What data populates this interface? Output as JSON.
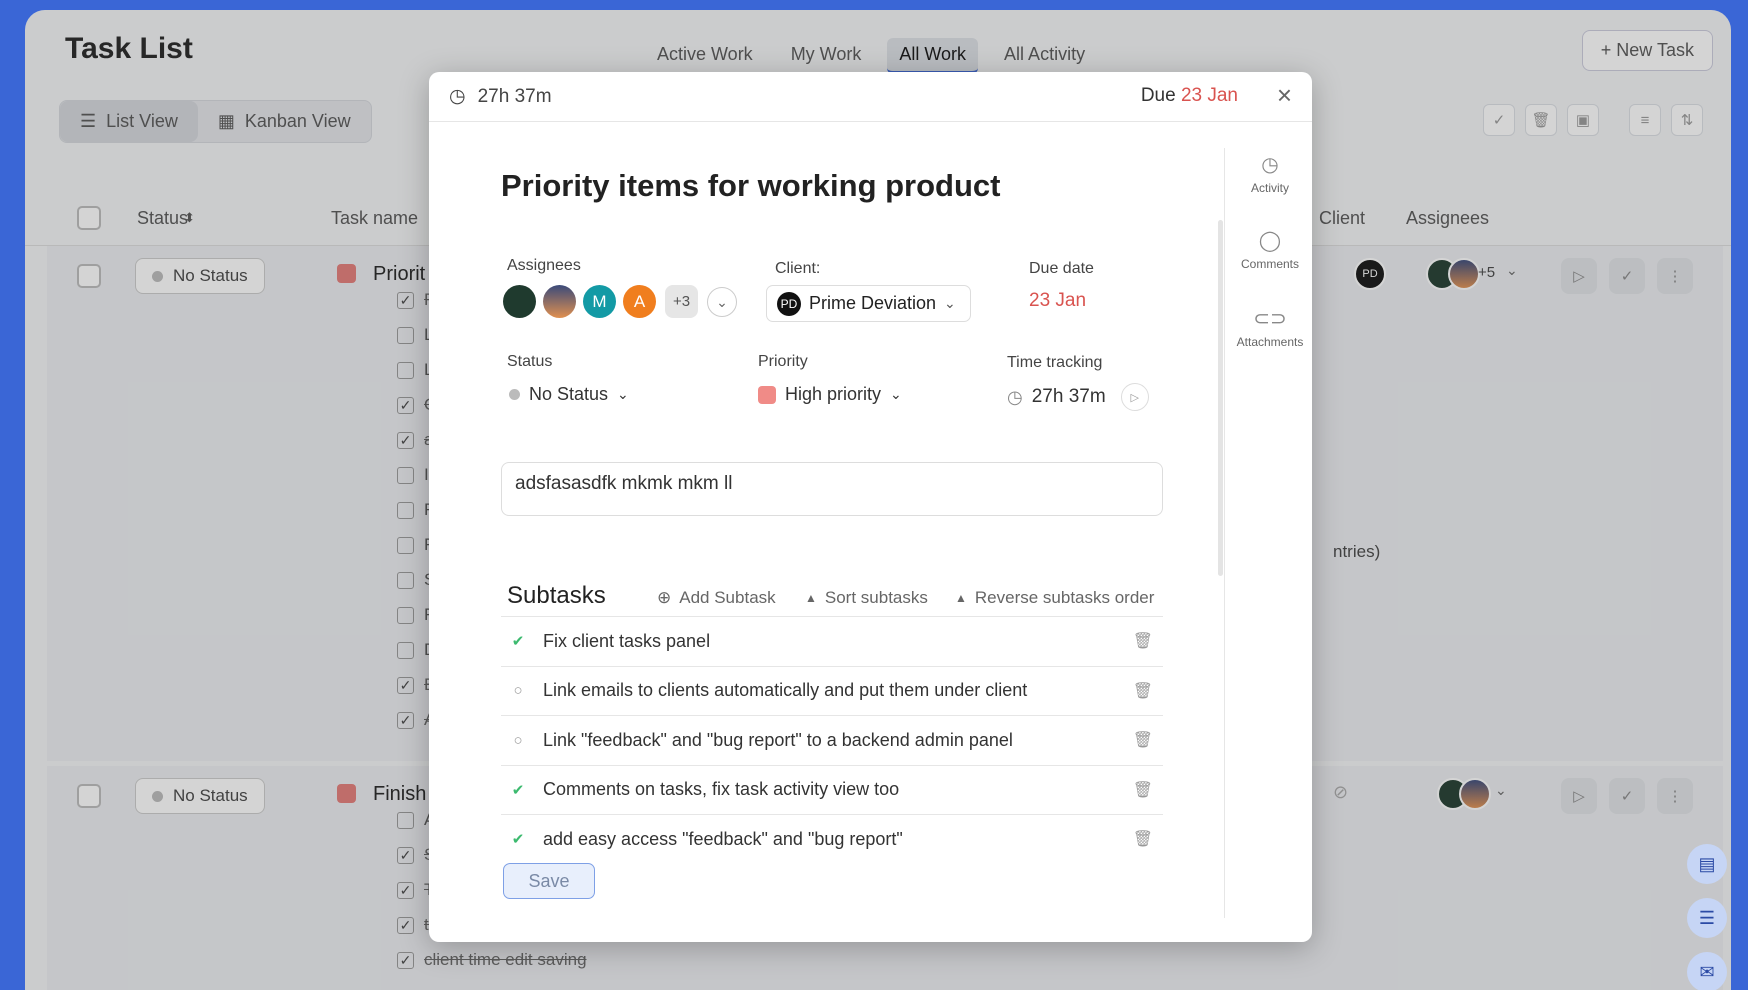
{
  "app": {
    "title": "Task List",
    "tabs": [
      "Active Work",
      "My Work",
      "All Work",
      "All Activity"
    ],
    "active_tab": "All Work",
    "new_task_label": "+ New Task",
    "views": {
      "list": "List View",
      "kanban": "Kanban View"
    }
  },
  "table": {
    "headers": {
      "status": "Status",
      "task_name": "Task name",
      "client": "Client",
      "assignees": "Assignees"
    },
    "rows": [
      {
        "status": "No Status",
        "task": "Priorit",
        "more_assignees": "+5",
        "subtasks": [
          {
            "text": "Fix",
            "done": true
          },
          {
            "text": "Lin",
            "done": false
          },
          {
            "text": "Lin",
            "done": false
          },
          {
            "text": "Cor",
            "done": true
          },
          {
            "text": "ade",
            "done": true
          },
          {
            "text": "Imp",
            "done": false
          },
          {
            "text": "Rer",
            "done": false
          },
          {
            "text": "Rec",
            "done": false
          },
          {
            "text": "Syr",
            "done": false
          },
          {
            "text": "Fin",
            "done": false
          },
          {
            "text": "Das",
            "done": false
          },
          {
            "text": "Em",
            "done": true
          },
          {
            "text": "Act",
            "done": true
          }
        ],
        "behind_text": "ntries)"
      },
      {
        "status": "No Status",
        "task": "Finish",
        "subtasks": [
          {
            "text": "Abi",
            "done": false
          },
          {
            "text": "She",
            "done": true
          },
          {
            "text": "Tim",
            "done": true
          },
          {
            "text": "tim",
            "done": true
          },
          {
            "text": "client time edit saving",
            "done": true
          }
        ]
      }
    ]
  },
  "modal": {
    "time": "27h 37m",
    "due_prefix": "Due",
    "due_date": "23 Jan",
    "title": "Priority items for working product",
    "assignees_label": "Assignees",
    "assignees": [
      {
        "initial": "",
        "color": "#1f3a2e"
      },
      {
        "initial": "",
        "color": "#d97a3a"
      },
      {
        "initial": "M",
        "color": "#139aa5"
      },
      {
        "initial": "A",
        "color": "#f07e1e"
      }
    ],
    "assignees_more": "+3",
    "client_label": "Client:",
    "client_name": "Prime Deviation",
    "client_logo": "PD",
    "due_label": "Due date",
    "status_label": "Status",
    "status_value": "No Status",
    "priority_label": "Priority",
    "priority_value": "High priority",
    "priority_color": "#f08b87",
    "tracking_label": "Time tracking",
    "tracking_value": "27h 37m",
    "description": "adsfasasdfk mkmk mkm ll",
    "subtasks_title": "Subtasks",
    "add_subtask": "Add Subtask",
    "sort_subtasks": "Sort subtasks",
    "reverse_subtasks": "Reverse subtasks order",
    "subtasks": [
      {
        "text": "Fix client tasks panel",
        "done": true
      },
      {
        "text": "Link emails to clients automatically and put them under client",
        "done": false
      },
      {
        "text": "Link \"feedback\" and \"bug report\" to a backend admin panel",
        "done": false
      },
      {
        "text": "Comments on tasks, fix task activity view too",
        "done": true
      },
      {
        "text": "add easy access \"feedback\" and \"bug report\"",
        "done": true
      }
    ],
    "save_label": "Save",
    "side": {
      "activity": "Activity",
      "comments": "Comments",
      "attachments": "Attachments"
    }
  },
  "colors": {
    "accent": "#3a66d6",
    "done": "#3cba6f",
    "due": "#d9534f"
  }
}
